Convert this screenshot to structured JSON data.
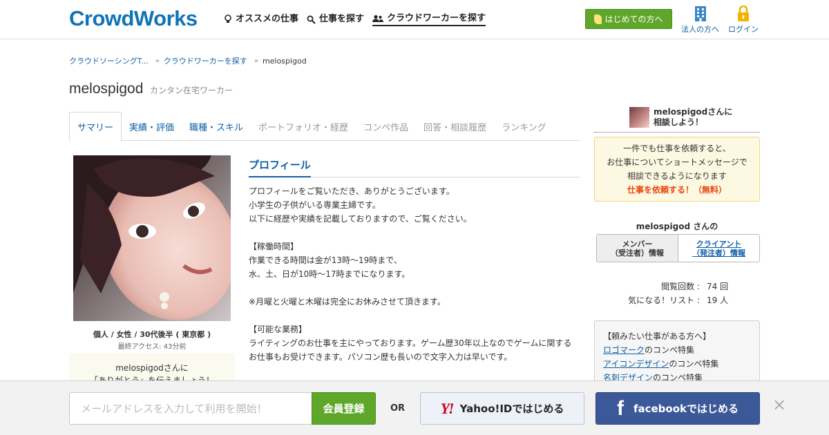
{
  "header": {
    "logo": "CrowdWorks",
    "nav": [
      {
        "label": "オススメの仕事",
        "icon": "lightbulb-icon"
      },
      {
        "label": "仕事を探す",
        "icon": "search-icon"
      },
      {
        "label": "クラウドワーカーを探す",
        "icon": "users-icon"
      }
    ],
    "beginner_button": "はじめての方へ",
    "corporate_link": "法人の方へ",
    "login_link": "ログイン"
  },
  "breadcrumb": [
    "クラウドソーシングT...",
    "クラウドワーカーを探す",
    "melospigod"
  ],
  "user": {
    "name": "melospigod",
    "type": "カンタン在宅ワーカー",
    "meta": "個人 / 女性 / 30代後半 ( 東京都 )",
    "last_access": "最終アクセス: 43分前",
    "thanks_line1": "melospigodさんに",
    "thanks_line2": "「ありがとう」を伝えましょう！"
  },
  "tabs": [
    {
      "label": "サマリー",
      "state": "active"
    },
    {
      "label": "実績・評価",
      "state": "link"
    },
    {
      "label": "職種・スキル",
      "state": "link"
    },
    {
      "label": "ポートフォリオ・経歴",
      "state": "disabled"
    },
    {
      "label": "コンペ作品",
      "state": "disabled"
    },
    {
      "label": "回答・相談履歴",
      "state": "disabled"
    },
    {
      "label": "ランキング",
      "state": "disabled"
    }
  ],
  "profile": {
    "heading": "プロフィール",
    "lines": [
      "プロフィールをご覧いただき、ありがとうございます。",
      "小学生の子供がいる専業主婦です。",
      "以下に経歴や実績を記載しておりますので、ご覧ください。",
      "",
      "【稼働時間】",
      "作業できる時間は金が13時～19時まで、",
      "水、土、日が10時～17時までになります。",
      "",
      "※月曜と火曜と木曜は完全にお休みさせて頂きます。",
      "",
      "【可能な業務】",
      "ライティングのお仕事を主にやっております。ゲーム歴30年以上なのでゲームに関する",
      "お仕事もお受けできます。パソコン歴も長いので文字入力は早いです。"
    ]
  },
  "sidebar": {
    "consult_line1": "melospigodさんに",
    "consult_line2": "相談しよう！",
    "request_line1": "一件でも仕事を依頼すると、",
    "request_line2": "お仕事についてショートメッセージで",
    "request_line3": "相談できるようになります",
    "request_cta": "仕事を依頼する！（無料）",
    "info_title": "melospigod さんの",
    "member_info_line1": "メンバー",
    "member_info_line2": "（受注者）情報",
    "client_info_line1": "クライアント",
    "client_info_line2": "（発注者）情報",
    "stats": [
      {
        "label": "閲覧回数 :",
        "value": "74 回"
      },
      {
        "label": "気になる！リスト :",
        "value": "19 人"
      }
    ],
    "jobs_title": "【頼みたい仕事がある方へ】",
    "jobs": [
      {
        "link": "ロゴマーク",
        "suffix": "のコンペ特集"
      },
      {
        "link": "アイコンデザイン",
        "suffix": "のコンペ特集"
      },
      {
        "link": "名刺デザイン",
        "suffix": "のコンペ特集"
      }
    ]
  },
  "footer": {
    "email_placeholder": "メールアドレスを入力して利用を開始！",
    "register_button": "会員登録",
    "or": "OR",
    "yahoo_logo": "Y!",
    "yahoo_button": "Yahoo!IDではじめる",
    "facebook_logo": "f",
    "facebook_button": "facebookではじめる",
    "close": "×"
  },
  "colors": {
    "brand": "#0f73b8",
    "link": "#0d5ea8",
    "green": "#5fa72a",
    "cta_orange": "#e8470f",
    "facebook": "#3b5998"
  }
}
